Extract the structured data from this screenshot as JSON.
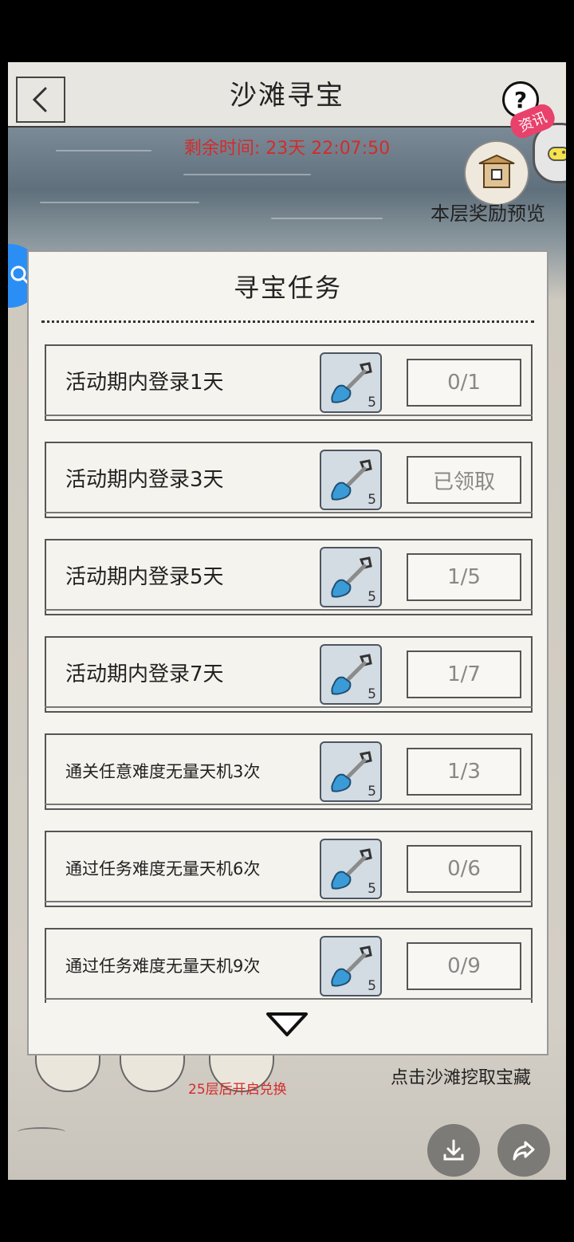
{
  "header": {
    "title": "沙滩寻宝",
    "help": "?"
  },
  "timer": {
    "text": "剩余时间: 23天 22:07:50"
  },
  "news_badge": "资讯",
  "reward_preview": {
    "label": "本层奖励预览"
  },
  "modal": {
    "title": "寻宝任务",
    "tasks": [
      {
        "label": "活动期内登录1天",
        "reward_count": "5",
        "status": "0/1"
      },
      {
        "label": "活动期内登录3天",
        "reward_count": "5",
        "status": "已领取"
      },
      {
        "label": "活动期内登录5天",
        "reward_count": "5",
        "status": "1/5"
      },
      {
        "label": "活动期内登录7天",
        "reward_count": "5",
        "status": "1/7"
      },
      {
        "label": "通关任意难度无量天机3次",
        "reward_count": "5",
        "status": "1/3"
      },
      {
        "label": "通过任务难度无量天机6次",
        "reward_count": "5",
        "status": "0/6"
      },
      {
        "label": "通过任务难度无量天机9次",
        "reward_count": "5",
        "status": "0/9"
      }
    ]
  },
  "bottom": {
    "unlock_text": "25层后开启兑换",
    "dig_hint": "点击沙滩挖取宝藏"
  },
  "colors": {
    "timer": "#d42b2b",
    "badge": "#e8416b",
    "float_button": "#2b8ef5",
    "shovel_blade": "#3b9bd6"
  }
}
